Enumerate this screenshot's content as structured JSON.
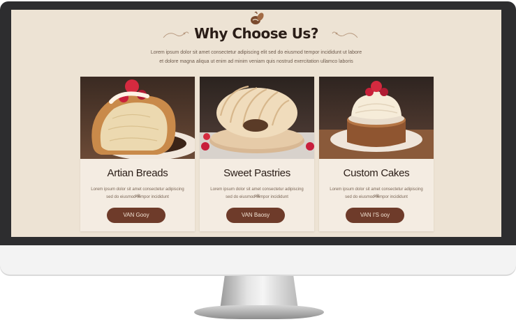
{
  "header": {
    "title": "Why Choose Us?",
    "subtitle_line1": "Lorem ipsum dolor sit amet consectetur adipiscing elit sed do eiusmod tempor incididunt ut labore",
    "subtitle_line2": "et dolore magna aliqua ut enim ad minim veniam quis nostrud exercitation ullamco laboris"
  },
  "cards": [
    {
      "title": "Artian Breads",
      "desc_line1": "Lorem ipsum dolor sit amet consectetur adipiscing elit",
      "desc_line2": "sed do eiusmod tempor incididunt",
      "button": "VAN Gooy"
    },
    {
      "title": "Sweet Pastries",
      "desc_line1": "Lorem ipsum dolor sit amet consectetur adipiscing elit",
      "desc_line2": "sed do eiusmod tempor incididunt",
      "button": "VAN Baosy"
    },
    {
      "title": "Custom Cakes",
      "desc_line1": "Lorem ipsum dolor sit amet consectetur adipiscing elit",
      "desc_line2": "sed do eiusmod tempor incididunt",
      "button": "VAN I'S ooy"
    }
  ],
  "colors": {
    "page_bg": "#ede3d4",
    "card_bg": "#f4ece2",
    "button": "#6e3b2a",
    "bezel": "#2d2d2f"
  },
  "icons": {
    "logo": "coffee-bean-leaf-icon",
    "ornament": "swirl-ornament-icon"
  }
}
